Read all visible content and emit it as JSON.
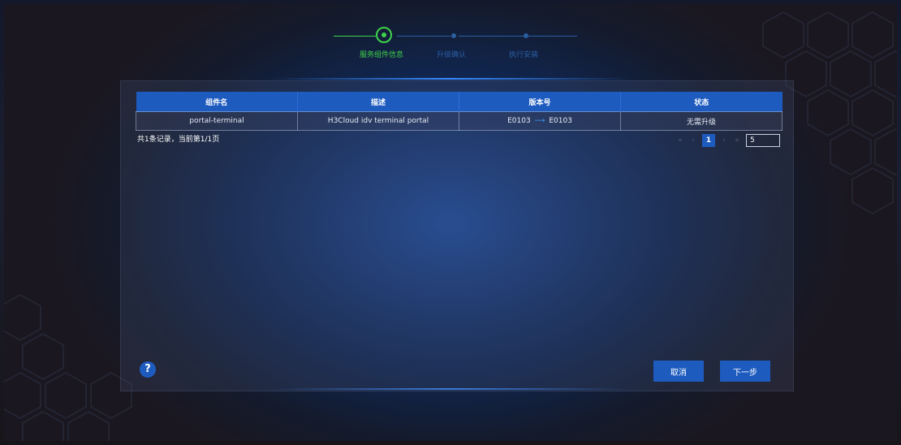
{
  "stepper": {
    "steps": [
      {
        "label": "服务组件信息",
        "state": "active"
      },
      {
        "label": "升级确认",
        "state": "pending"
      },
      {
        "label": "执行安装",
        "state": "pending"
      }
    ]
  },
  "table": {
    "columns": [
      "组件名",
      "描述",
      "版本号",
      "状态"
    ],
    "rows": [
      {
        "name": "portal-terminal",
        "description": "H3Cloud idv terminal portal",
        "version_from": "E0103",
        "version_to": "E0103",
        "status": "无需升级"
      }
    ],
    "summary": "共1条记录，当前第1/1页"
  },
  "pagination": {
    "first": "«",
    "prev": "‹",
    "current_page": "1",
    "next": "›",
    "last": "»",
    "page_size": "5"
  },
  "footer": {
    "help": "?",
    "cancel_label": "取消",
    "next_label": "下一步"
  },
  "colors": {
    "accent": "#1e5bbf",
    "active_step": "#3fd24a",
    "pending_step": "#2b5fa7"
  }
}
